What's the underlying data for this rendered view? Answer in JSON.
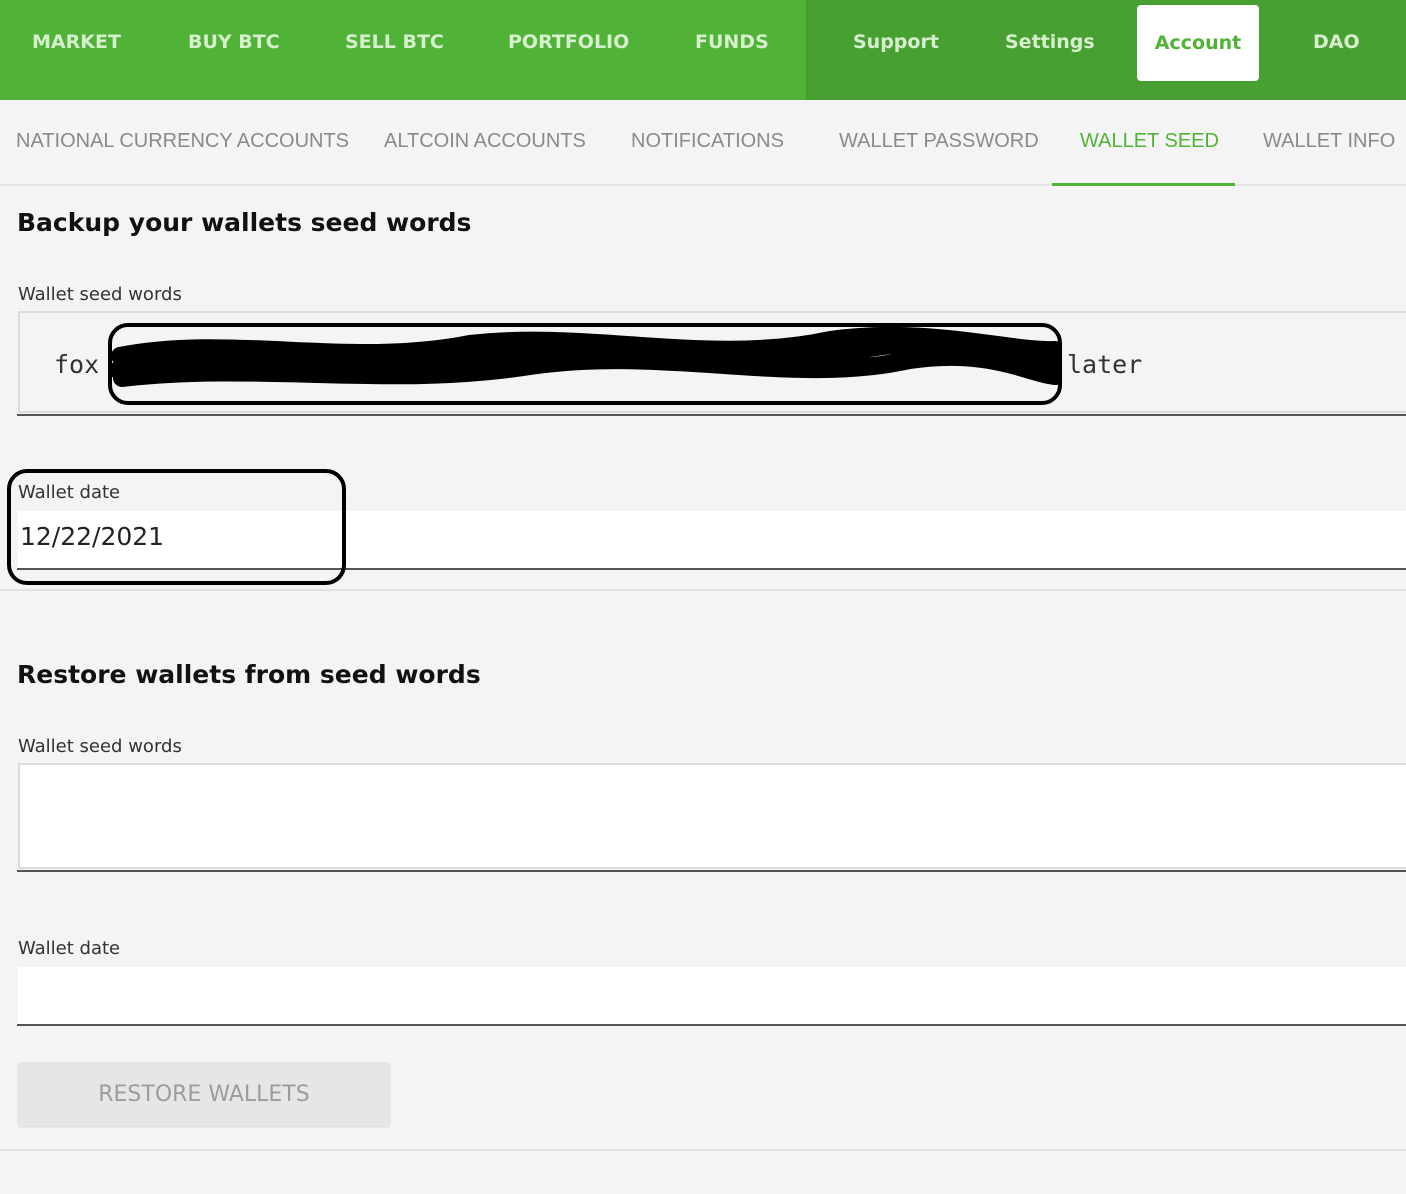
{
  "nav": {
    "items": [
      "MARKET",
      "BUY BTC",
      "SELL BTC",
      "PORTFOLIO",
      "FUNDS",
      "Support",
      "Settings",
      "Account",
      "DAO"
    ],
    "active": "Account"
  },
  "subnav": {
    "items": [
      "NATIONAL CURRENCY ACCOUNTS",
      "ALTCOIN ACCOUNTS",
      "NOTIFICATIONS",
      "WALLET PASSWORD",
      "WALLET SEED",
      "WALLET INFO"
    ],
    "active": "WALLET SEED"
  },
  "backup": {
    "heading": "Backup your wallets seed words",
    "seed_label": "Wallet seed words",
    "seed_first_word": "fox",
    "seed_last_word": "later",
    "date_label": "Wallet date",
    "date_value": "12/22/2021"
  },
  "restore": {
    "heading": "Restore wallets from seed words",
    "seed_label": "Wallet seed words",
    "seed_value": "",
    "date_label": "Wallet date",
    "date_value": "",
    "button_label": "RESTORE WALLETS",
    "button_enabled": false
  },
  "colors": {
    "brand_green": "#50b337",
    "brand_green_dark": "#47a031",
    "muted_text": "#8a8a8a",
    "background": "#f4f4f4"
  }
}
